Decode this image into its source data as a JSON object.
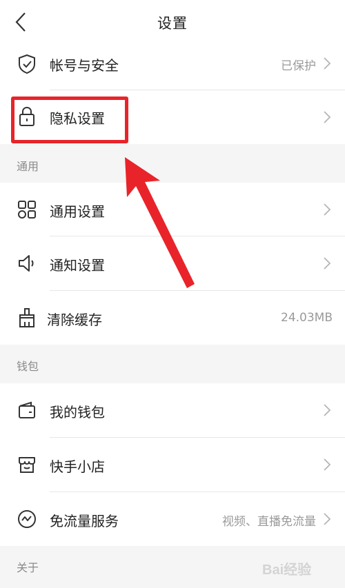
{
  "header": {
    "title": "设置",
    "back_icon": "chevron-left-icon"
  },
  "rows": {
    "account_security": {
      "label": "帐号与安全",
      "value": "已保护",
      "icon": "shield-check-icon"
    },
    "privacy": {
      "label": "隐私设置",
      "icon": "lock-icon"
    },
    "general_settings": {
      "label": "通用设置",
      "icon": "grid-four-icon"
    },
    "notification": {
      "label": "通知设置",
      "icon": "speaker-icon"
    },
    "clear_cache": {
      "label": "清除缓存",
      "value": "24.03MB",
      "icon": "broom-icon"
    },
    "wallet": {
      "label": "我的钱包",
      "icon": "wallet-icon"
    },
    "shop": {
      "label": "快手小店",
      "icon": "store-icon"
    },
    "data_free": {
      "label": "免流量服务",
      "value": "视频、直播免流量",
      "icon": "wave-circle-icon"
    }
  },
  "sections": {
    "general": "通用",
    "wallet": "钱包",
    "about": "关于"
  },
  "annotation": {
    "highlight_color": "#e8242a",
    "arrow_color": "#e8242a"
  },
  "watermark": {
    "text": "Bai经验"
  },
  "colors": {
    "background": "#ffffff",
    "section_bg": "#f5f5f5",
    "secondary_text": "#9a9a9a"
  }
}
